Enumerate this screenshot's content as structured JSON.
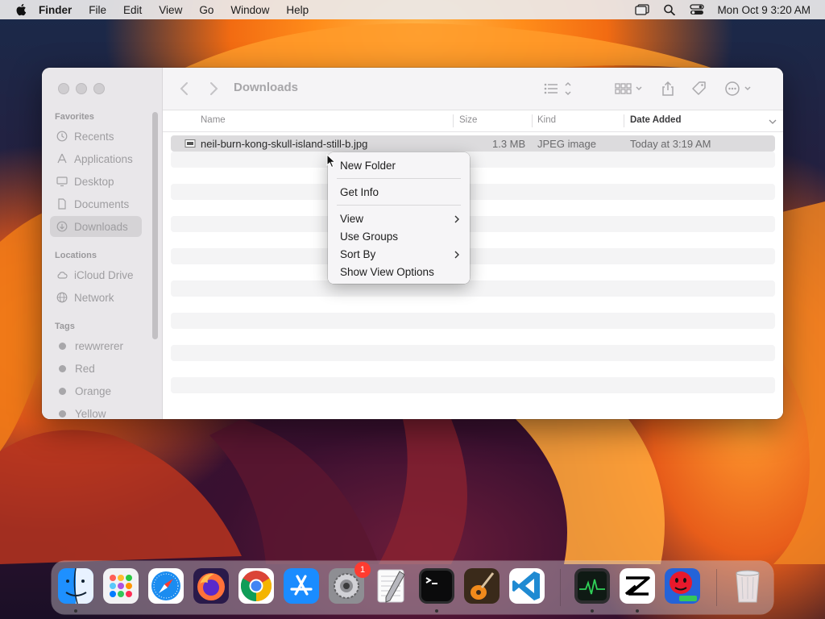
{
  "menubar": {
    "app_name": "Finder",
    "items": [
      "File",
      "Edit",
      "View",
      "Go",
      "Window",
      "Help"
    ],
    "clock": "Mon Oct 9  3:20 AM"
  },
  "window": {
    "title": "Downloads"
  },
  "sidebar": {
    "favorites_heading": "Favorites",
    "favorites": [
      {
        "label": "Recents",
        "icon": "clock-icon"
      },
      {
        "label": "Applications",
        "icon": "applications-icon"
      },
      {
        "label": "Desktop",
        "icon": "desktop-icon"
      },
      {
        "label": "Documents",
        "icon": "document-icon"
      },
      {
        "label": "Downloads",
        "icon": "download-icon",
        "selected": true
      }
    ],
    "locations_heading": "Locations",
    "locations": [
      {
        "label": "iCloud Drive",
        "icon": "cloud-icon"
      },
      {
        "label": "Network",
        "icon": "globe-icon"
      }
    ],
    "tags_heading": "Tags",
    "tags": [
      {
        "label": "rewwrerer"
      },
      {
        "label": "Red"
      },
      {
        "label": "Orange"
      },
      {
        "label": "Yellow"
      }
    ]
  },
  "columns": {
    "name": "Name",
    "size": "Size",
    "kind": "Kind",
    "date_added": "Date Added"
  },
  "files": [
    {
      "name": "neil-burn-kong-skull-island-still-b.jpg",
      "size": "1.3 MB",
      "kind": "JPEG image",
      "date_added": "Today at 3:19 AM"
    }
  ],
  "context_menu": {
    "items": [
      {
        "label": "New Folder"
      },
      {
        "label": "Get Info"
      },
      {
        "label": "View",
        "submenu": true
      },
      {
        "label": "Use Groups"
      },
      {
        "label": "Sort By",
        "submenu": true
      },
      {
        "label": "Show View Options"
      }
    ]
  },
  "dock": {
    "apps": [
      {
        "name": "finder-icon",
        "running": true
      },
      {
        "name": "launchpad-icon"
      },
      {
        "name": "safari-icon"
      },
      {
        "name": "firefox-icon"
      },
      {
        "name": "chrome-icon"
      },
      {
        "name": "app-store-icon"
      },
      {
        "name": "system-settings-icon",
        "badge": "1"
      },
      {
        "name": "textedit-icon"
      },
      {
        "name": "terminal-icon",
        "running": true
      },
      {
        "name": "garageband-icon"
      },
      {
        "name": "vscode-icon"
      },
      {
        "name": "activity-monitor-icon",
        "running": true
      },
      {
        "name": "capcut-icon",
        "running": true
      },
      {
        "name": "app-icon"
      },
      {
        "name": "trash-icon"
      }
    ],
    "system_settings_badge": "1"
  }
}
